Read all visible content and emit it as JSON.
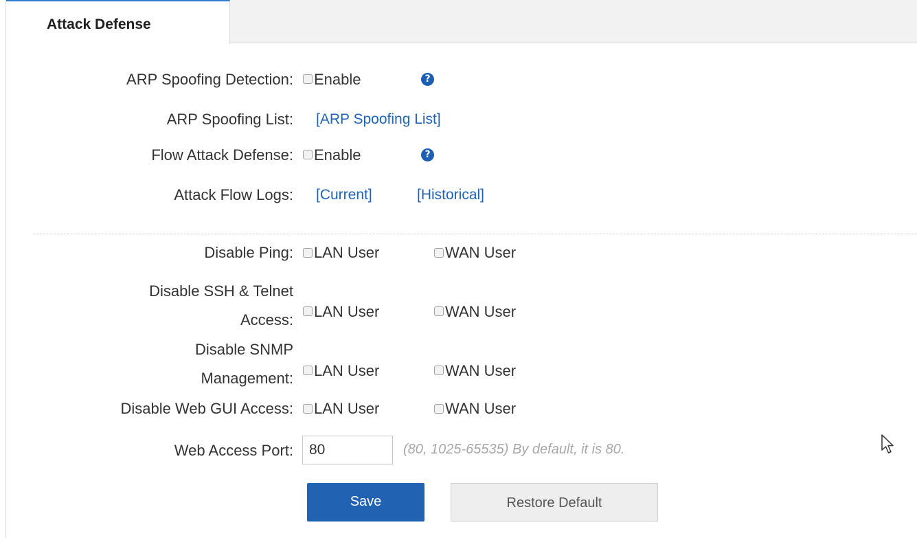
{
  "tab": {
    "title": "Attack Defense"
  },
  "arp_detection": {
    "label": "ARP Spoofing Detection:",
    "option": "Enable",
    "help": "?"
  },
  "arp_list": {
    "label": "ARP Spoofing List:",
    "link": "[ARP Spoofing List]"
  },
  "flow_defense": {
    "label": "Flow Attack Defense:",
    "option": "Enable",
    "help": "?"
  },
  "flow_logs": {
    "label": "Attack Flow Logs:",
    "current": "[Current]",
    "historical": "[Historical]"
  },
  "disable_ping": {
    "label": "Disable Ping:",
    "lan": "LAN User",
    "wan": "WAN User"
  },
  "disable_ssh": {
    "label_line1": "Disable SSH & Telnet",
    "label_line2": "Access:",
    "lan": "LAN User",
    "wan": "WAN User"
  },
  "disable_snmp": {
    "label_line1": "Disable SNMP",
    "label_line2": "Management:",
    "lan": "LAN User",
    "wan": "WAN User"
  },
  "disable_web": {
    "label": "Disable Web GUI Access:",
    "lan": "LAN User",
    "wan": "WAN User"
  },
  "web_port": {
    "label": "Web Access Port:",
    "value": "80",
    "hint": "(80, 1025-65535) By default, it is 80."
  },
  "buttons": {
    "save": "Save",
    "restore": "Restore Default"
  },
  "colors": {
    "accent": "#2262b3",
    "link": "#1f63b8",
    "tab_border": "#2e7bcf"
  },
  "icons": {
    "help": "question-circle-icon",
    "cursor": "mouse-pointer-icon"
  }
}
